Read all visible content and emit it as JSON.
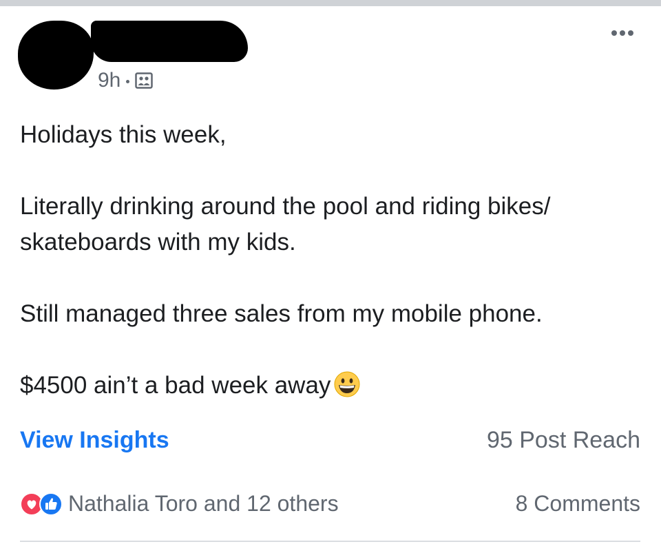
{
  "post": {
    "author_redacted": true,
    "time": "9h",
    "audience_icon": "friends-icon",
    "more_icon": "more-options-icon",
    "text": {
      "line1": "Holidays this week,",
      "line2": "Literally drinking around the pool and riding bikes/ skateboards with my kids.",
      "line3": "Still managed three sales from my mobile phone.",
      "line4": "$4500 ain’t a bad week away",
      "line4_emoji": "grinning-face-emoji"
    }
  },
  "insights": {
    "link_label": "View Insights",
    "reach": "95 Post Reach",
    "link_color": "#1877f2"
  },
  "engagement": {
    "reaction_icons": [
      "love-reaction-icon",
      "like-reaction-icon"
    ],
    "reactors": "Nathalia Toro and 12 others",
    "comments": "8 Comments"
  },
  "colors": {
    "text_primary": "#1c1e21",
    "text_secondary": "#606770",
    "love": "#f33e58",
    "like": "#1877f2"
  }
}
